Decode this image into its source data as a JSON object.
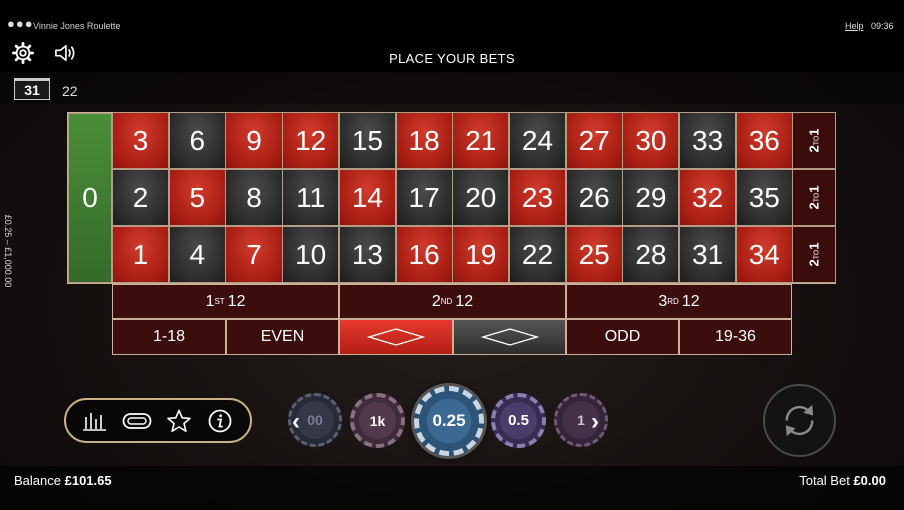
{
  "status_bar": {
    "app_title": "Vinnie Jones Roulette",
    "help": "Help",
    "time": "09:36"
  },
  "header": {
    "title": "PLACE YOUR BETS",
    "settings_icon": "gear-icon",
    "sound_icon": "speaker-icon"
  },
  "history": {
    "last": "31",
    "previous": "22"
  },
  "limits": "£0.25 – £1,000.00",
  "table": {
    "zero": "0",
    "rows": [
      [
        {
          "n": "3",
          "c": "red"
        },
        {
          "n": "6",
          "c": "black"
        },
        {
          "n": "9",
          "c": "red"
        },
        {
          "n": "12",
          "c": "red"
        },
        {
          "n": "15",
          "c": "black"
        },
        {
          "n": "18",
          "c": "red"
        },
        {
          "n": "21",
          "c": "red"
        },
        {
          "n": "24",
          "c": "black"
        },
        {
          "n": "27",
          "c": "red"
        },
        {
          "n": "30",
          "c": "red"
        },
        {
          "n": "33",
          "c": "black"
        },
        {
          "n": "36",
          "c": "red"
        }
      ],
      [
        {
          "n": "2",
          "c": "black"
        },
        {
          "n": "5",
          "c": "red"
        },
        {
          "n": "8",
          "c": "black"
        },
        {
          "n": "11",
          "c": "black"
        },
        {
          "n": "14",
          "c": "red"
        },
        {
          "n": "17",
          "c": "black"
        },
        {
          "n": "20",
          "c": "black"
        },
        {
          "n": "23",
          "c": "red"
        },
        {
          "n": "26",
          "c": "black"
        },
        {
          "n": "29",
          "c": "black"
        },
        {
          "n": "32",
          "c": "red"
        },
        {
          "n": "35",
          "c": "black"
        }
      ],
      [
        {
          "n": "1",
          "c": "red"
        },
        {
          "n": "4",
          "c": "black"
        },
        {
          "n": "7",
          "c": "red"
        },
        {
          "n": "10",
          "c": "black"
        },
        {
          "n": "13",
          "c": "black"
        },
        {
          "n": "16",
          "c": "red"
        },
        {
          "n": "19",
          "c": "red"
        },
        {
          "n": "22",
          "c": "black"
        },
        {
          "n": "25",
          "c": "red"
        },
        {
          "n": "28",
          "c": "black"
        },
        {
          "n": "31",
          "c": "black"
        },
        {
          "n": "34",
          "c": "red"
        }
      ]
    ],
    "column_bet": {
      "num": "2",
      "sup": "TO",
      "num2": "1"
    },
    "dozens": [
      {
        "ord": "1",
        "sup": "ST",
        "num": "12"
      },
      {
        "ord": "2",
        "sup": "ND",
        "num": "12"
      },
      {
        "ord": "3",
        "sup": "RD",
        "num": "12"
      }
    ],
    "even_money": {
      "low": "1-18",
      "even": "EVEN",
      "odd": "ODD",
      "high": "19-36"
    },
    "colors": {
      "red": "#b31d15",
      "black": "#2b2b2b",
      "green": "#356a29",
      "border": "#c7b199"
    }
  },
  "controls": {
    "stats_icon": "bar-chart-icon",
    "racetrack_icon": "racetrack-icon",
    "favourites_icon": "star-icon",
    "info_icon": "info-icon",
    "spin_icon": "repeat-icon"
  },
  "chips": {
    "c100": "00",
    "c1k": "1k",
    "selected": "0.25",
    "c05": "0.5",
    "c1": "1"
  },
  "footer": {
    "balance_label": "Balance",
    "balance": "£101.65",
    "total_bet_label": "Total Bet",
    "total_bet": "£0.00"
  }
}
